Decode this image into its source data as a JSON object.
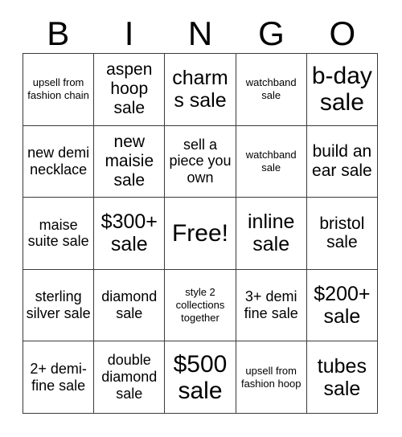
{
  "header": {
    "letters": [
      "B",
      "I",
      "N",
      "G",
      "O"
    ]
  },
  "grid": {
    "columns": 5,
    "rows": 5,
    "free_space_label": "Free!",
    "cells": [
      {
        "text": "upsell from fashion chain",
        "size": "xs"
      },
      {
        "text": "aspen hoop sale",
        "size": "lg"
      },
      {
        "text": "charms sale",
        "size": "xl"
      },
      {
        "text": "watchband sale",
        "size": "xs"
      },
      {
        "text": "b-day sale",
        "size": "xxl"
      },
      {
        "text": "new demi necklace",
        "size": "md"
      },
      {
        "text": "new maisie sale",
        "size": "lg"
      },
      {
        "text": "sell a piece you own",
        "size": "md"
      },
      {
        "text": "watchband sale",
        "size": "xs"
      },
      {
        "text": "build an ear sale",
        "size": "lg"
      },
      {
        "text": "maise suite sale",
        "size": "md"
      },
      {
        "text": "$300+ sale",
        "size": "xl"
      },
      {
        "text": "Free!",
        "size": "xxl"
      },
      {
        "text": "inline sale",
        "size": "xl"
      },
      {
        "text": "bristol sale",
        "size": "lg"
      },
      {
        "text": "sterling silver sale",
        "size": "md"
      },
      {
        "text": "diamond sale",
        "size": "md"
      },
      {
        "text": "style 2 collections together",
        "size": "xs"
      },
      {
        "text": "3+ demi fine sale",
        "size": "md"
      },
      {
        "text": "$200+ sale",
        "size": "xl"
      },
      {
        "text": "2+ demi- fine sale",
        "size": "md"
      },
      {
        "text": "double diamond sale",
        "size": "md"
      },
      {
        "text": "$500 sale",
        "size": "xxl"
      },
      {
        "text": "upsell from fashion hoop",
        "size": "xs"
      },
      {
        "text": "tubes sale",
        "size": "xl"
      }
    ]
  },
  "colors": {
    "background": "#ffffff",
    "text": "#000000",
    "border": "#3a3a3a"
  }
}
